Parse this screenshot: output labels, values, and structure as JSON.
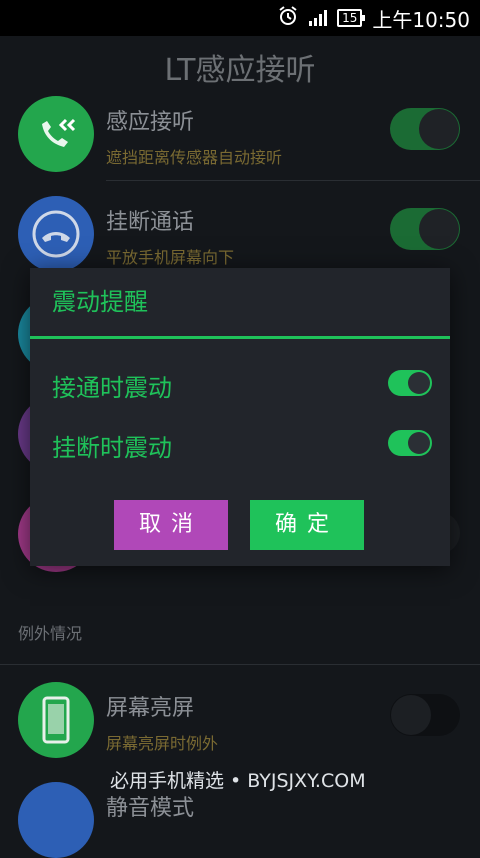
{
  "status_bar": {
    "battery": "15",
    "time": "上午10:50"
  },
  "app": {
    "title": "LT感应接听"
  },
  "rows": [
    {
      "title": "感应接听",
      "subtitle": "遮挡距离传感器自动接听",
      "icon": "phone-incoming-icon",
      "color": "#23a64d",
      "enabled": true
    },
    {
      "title": "挂断通话",
      "subtitle": "平放手机屏幕向下",
      "icon": "hangup-icon",
      "color": "#2d5fb5",
      "enabled": true
    }
  ],
  "section": {
    "label": "例外情况"
  },
  "exception_rows": [
    {
      "title": "屏幕亮屏",
      "subtitle": "屏幕亮屏时例外",
      "icon": "smartphone-icon",
      "color": "#23a64d",
      "enabled": false
    },
    {
      "title": "静音模式"
    }
  ],
  "dialog": {
    "title": "震动提醒",
    "options": [
      {
        "label": "接通时震动",
        "enabled": true
      },
      {
        "label": "挂断时震动",
        "enabled": true
      }
    ],
    "cancel_label": "取消",
    "ok_label": "确定"
  },
  "watermark": "必用手机精选 • BYJSJXY.COM",
  "colors": {
    "accent_green": "#1fc25a",
    "cancel_purple": "#b048b8"
  }
}
